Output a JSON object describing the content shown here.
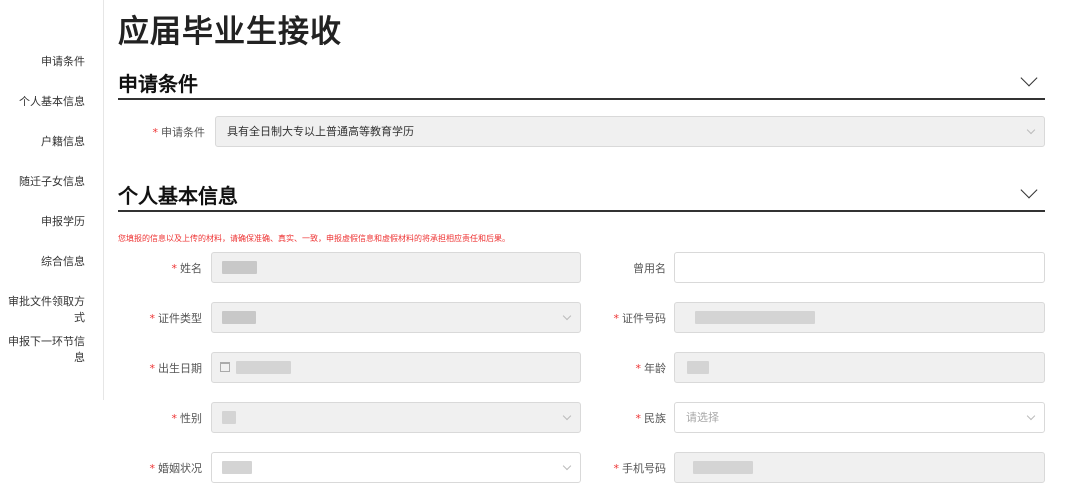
{
  "page": {
    "title": "应届毕业生接收"
  },
  "sidebar": {
    "items": [
      {
        "label": "申请条件"
      },
      {
        "label": "个人基本信息"
      },
      {
        "label": "户籍信息"
      },
      {
        "label": "随迁子女信息"
      },
      {
        "label": "申报学历"
      },
      {
        "label": "综合信息"
      },
      {
        "label": "审批文件领取方式"
      },
      {
        "label": "申报下一环节信息"
      }
    ]
  },
  "sections": {
    "apply": {
      "title": "申请条件",
      "condition_label": "申请条件",
      "condition_value": "具有全日制大专以上普通高等教育学历"
    },
    "personal": {
      "title": "个人基本信息",
      "notice": "您填报的信息以及上传的材料，请确保准确、真实、一致，申报虚假信息和虚假材料的将承担相应责任和后果。",
      "fields": {
        "name": "姓名",
        "former_name": "曾用名",
        "id_type": "证件类型",
        "id_number": "证件号码",
        "birth_date": "出生日期",
        "age": "年龄",
        "gender": "性别",
        "ethnicity": "民族",
        "ethnicity_placeholder": "请选择",
        "marital_status": "婚姻状况",
        "phone": "手机号码"
      }
    }
  }
}
